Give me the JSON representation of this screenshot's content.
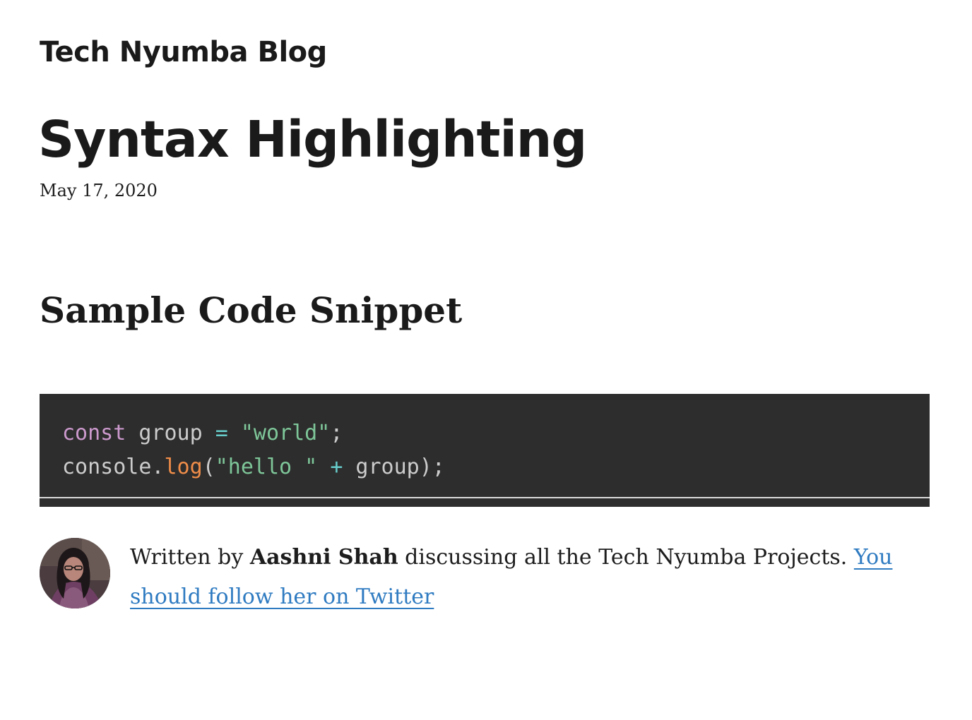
{
  "header": {
    "site_title": "Tech Nyumba Blog"
  },
  "post": {
    "title": "Syntax Highlighting",
    "date": "May 17, 2020"
  },
  "content": {
    "section_heading": "Sample Code Snippet",
    "code": {
      "line1": {
        "keyword": "const",
        "identifier": " group ",
        "operator": "=",
        "space": " ",
        "string": "\"world\"",
        "end": ";"
      },
      "line2": {
        "object": "console.",
        "method": "log",
        "open": "(",
        "string": "\"hello \"",
        "space1": " ",
        "operator": "+",
        "rest": " group);"
      }
    }
  },
  "bio": {
    "prefix": "Written by ",
    "author": "Aashni Shah",
    "middle": " discussing all the Tech Nyumba Projects. ",
    "link_text": "You should follow her on Twitter",
    "avatar_icon": "author-avatar-photo"
  },
  "colors": {
    "code_background": "#2d2d2d",
    "keyword": "#cc99cd",
    "string": "#7ec699",
    "operator": "#67cdcc",
    "function": "#f08d49",
    "link": "#2f7bc1"
  }
}
